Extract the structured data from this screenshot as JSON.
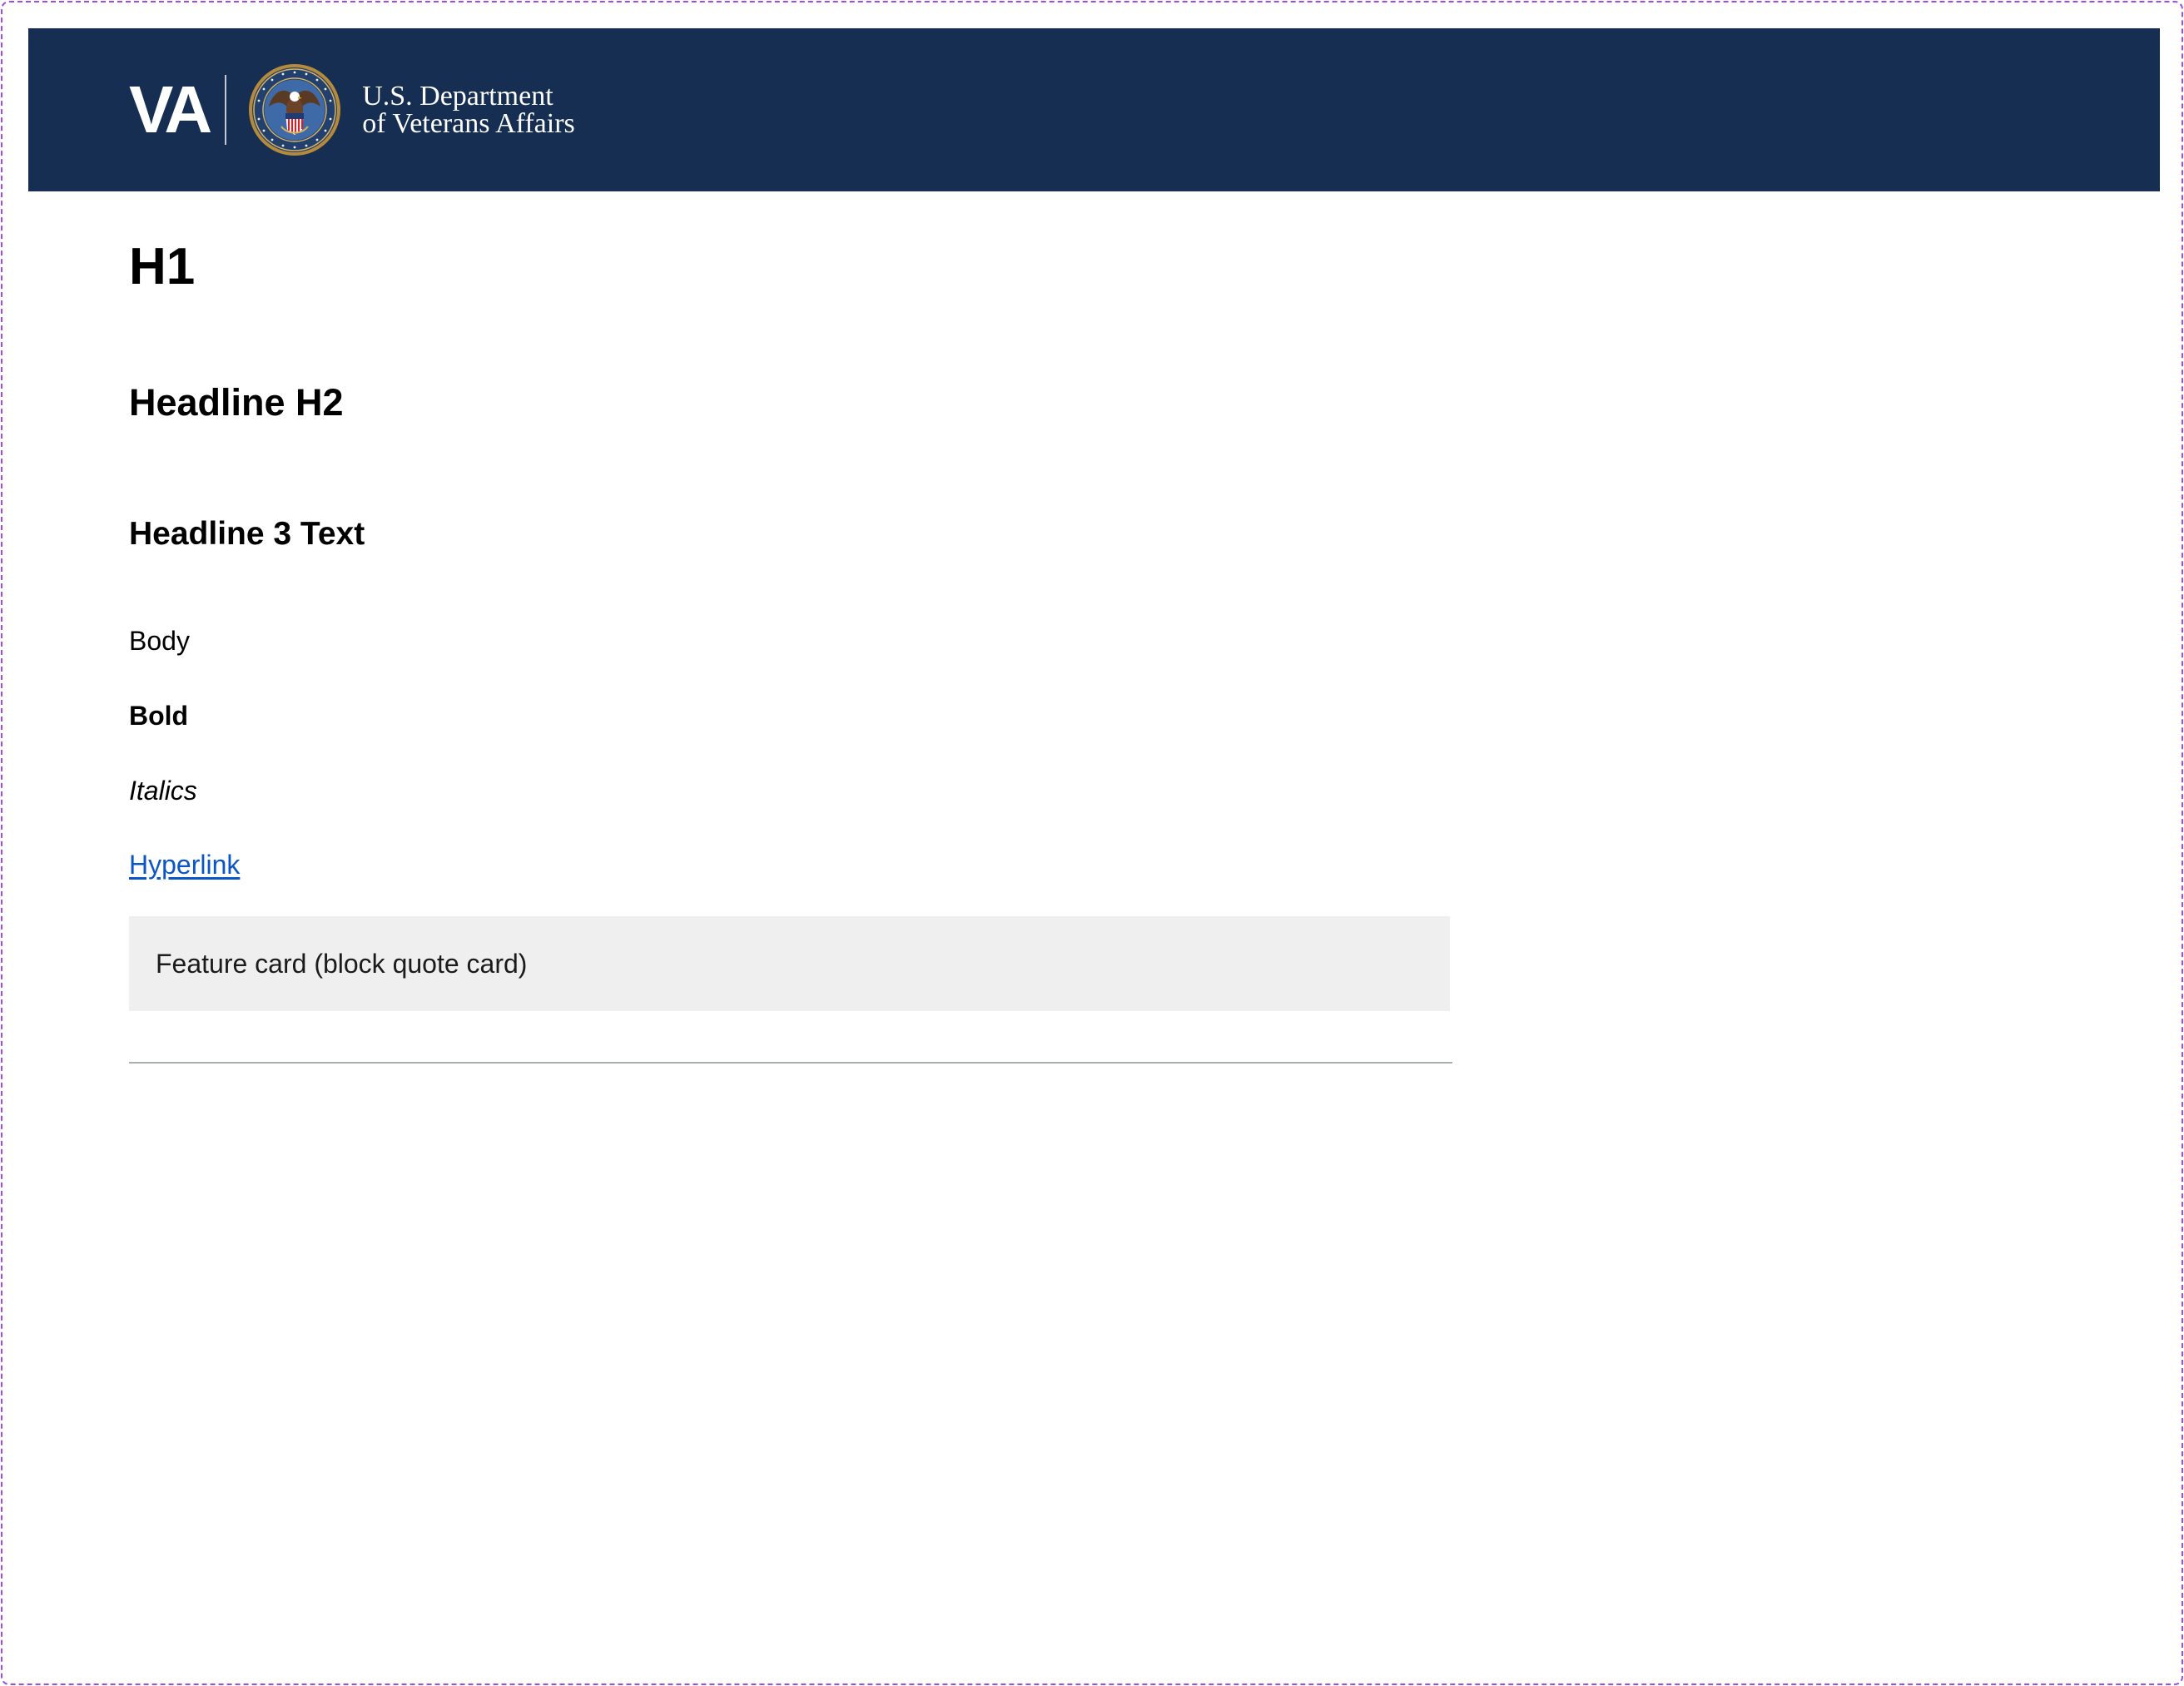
{
  "header": {
    "logo_wordmark": "VA",
    "department_line_1": "U.S. Department",
    "department_line_2": "of Veterans Affairs",
    "background_color": "#162e51"
  },
  "content": {
    "h1": "H1",
    "h2": "Headline H2",
    "h3": "Headline 3 Text",
    "body": "Body",
    "bold": "Bold",
    "italics": "Italics",
    "hyperlink": "Hyperlink",
    "feature_card": "Feature card (block quote card)",
    "link_color": "#0b55c5",
    "card_background": "#efefef"
  }
}
